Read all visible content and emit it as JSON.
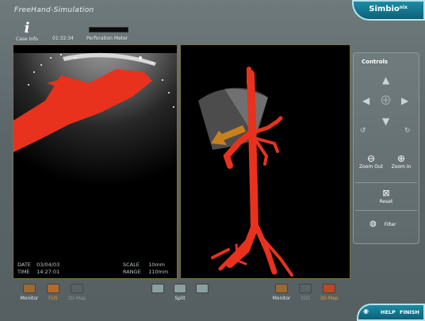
{
  "app_title": "FreeHand-Simulation",
  "brand": {
    "name": "Simbio",
    "suffix": "nix"
  },
  "toolbar": {
    "case_info_label": "Case Info",
    "timer": "01:32:34",
    "perforation_label": "Perforation Meter"
  },
  "left_panel": {
    "date_label": "DATE",
    "date_value": "03/04/03",
    "time_label": "TIME",
    "time_value": "14:27:01",
    "scale_label": "SCALE",
    "scale_value": "10mm",
    "range_label": "RANGE",
    "range_value": "110mm"
  },
  "controls": {
    "title": "Controls",
    "zoom_out": "Zoom Out",
    "zoom_in": "Zoom In",
    "reset": "Reset",
    "filter": "Filter"
  },
  "bottom": {
    "left_monitor": "Monitor",
    "left_fus": "FUS",
    "left_3dmap": "3D-Map",
    "split": "Split",
    "right_monitor": "Monitor",
    "right_3ds": "3DS",
    "right_3dmap": "3D-Map"
  },
  "footer": {
    "help": "HELP",
    "finish": "FINISH"
  },
  "colors": {
    "accent": "#f39a28",
    "vessel": "#e8321e",
    "brand_teal": "#1d8fa8"
  }
}
